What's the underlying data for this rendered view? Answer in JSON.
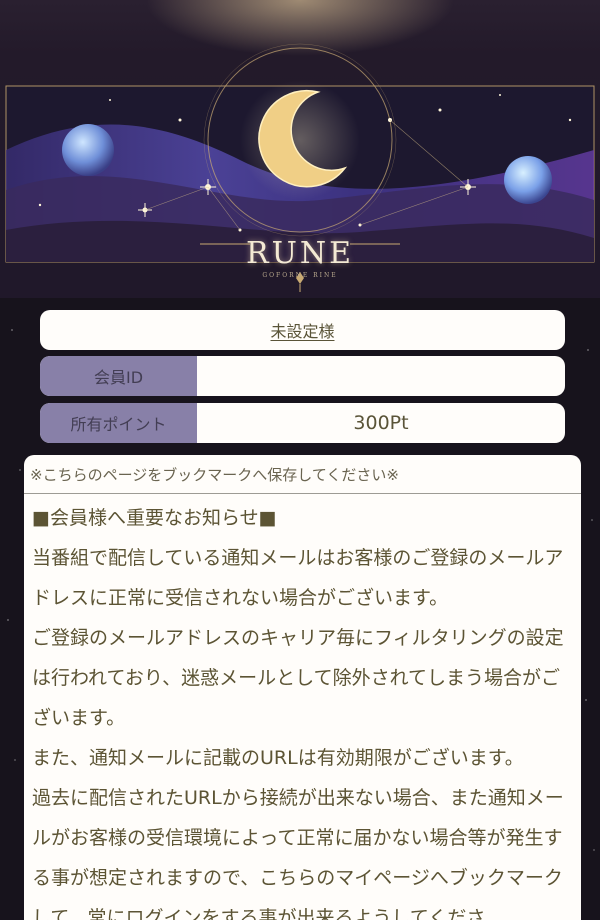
{
  "header": {
    "brand_title": "RUNE",
    "brand_subtitle": "GOFORNE RINE"
  },
  "member": {
    "name_link": "未設定様",
    "id_label": "会員ID",
    "id_value": "",
    "points_label": "所有ポイント",
    "points_value": "300Pt"
  },
  "notice": {
    "bookmark_note": "※こちらのページをブックマークへ保存してください※",
    "heading": "■会員様へ重要なお知らせ■",
    "paragraphs": [
      "当番組で配信している通知メールはお客様のご登録のメールアドレスに正常に受信されない場合がございます。",
      "ご登録のメールアドレスのキャリア毎にフィルタリングの設定は行われており、迷惑メールとして除外されてしまう場合がございます。",
      "また、通知メールに記載のURLは有効期限がございます。",
      "過去に配信されたURLから接続が出来ない場合、また通知メールがお客様の受信環境によって正常に届かない場合等が発生する事が想定されますので、こちらのマイページへブックマークして、常にログインをする事が出来るようしてくださ"
    ]
  }
}
